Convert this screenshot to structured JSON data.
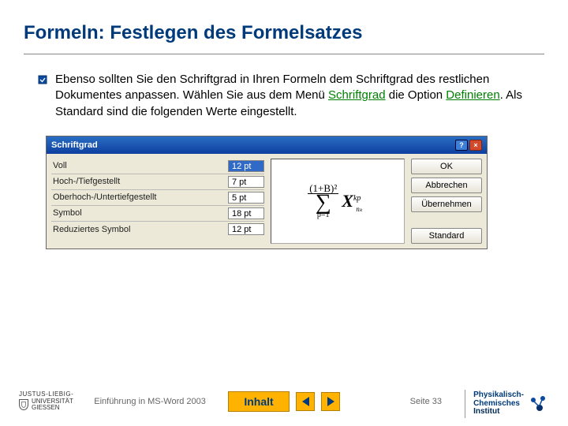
{
  "title": "Formeln: Festlegen des Formelsatzes",
  "body": {
    "t1": "Ebenso sollten Sie den Schriftgrad in Ihren Formeln dem Schriftgrad des restlichen Dokumentes anpassen. Wählen Sie aus dem Menü ",
    "g1": "Schriftgrad",
    "t2": " die Option ",
    "g2": "Definieren",
    "t3": ". Als Standard sind die folgenden Werte eingestellt."
  },
  "dialog": {
    "title": "Schriftgrad",
    "rows": [
      {
        "label": "Voll",
        "value": "12 pt",
        "selected": true
      },
      {
        "label": "Hoch-/Tiefgestellt",
        "value": "7 pt",
        "selected": false
      },
      {
        "label": "Oberhoch-/Untertiefgestellt",
        "value": "5 pt",
        "selected": false
      },
      {
        "label": "Symbol",
        "value": "18 pt",
        "selected": false
      },
      {
        "label": "Reduziertes Symbol",
        "value": "12 pt",
        "selected": false
      }
    ],
    "buttons": {
      "ok": "OK",
      "cancel": "Abbrechen",
      "apply": "Übernehmen",
      "std": "Standard"
    },
    "formula": {
      "numerator": "(1+B)²",
      "sigma_lower": "p=1",
      "X": "X",
      "sup": "kp",
      "sub": "nₖ"
    }
  },
  "footer": {
    "uni_top": "JUSTUS-LIEBIG-",
    "uni_mid": "UNIVERSITÄT",
    "uni_bot": "GIESSEN",
    "course": "Einführung in MS-Word 2003",
    "inhalt": "Inhalt",
    "page": "Seite 33",
    "pci1": "Physikalisch-",
    "pci2": "Chemisches",
    "pci3": "Institut"
  }
}
